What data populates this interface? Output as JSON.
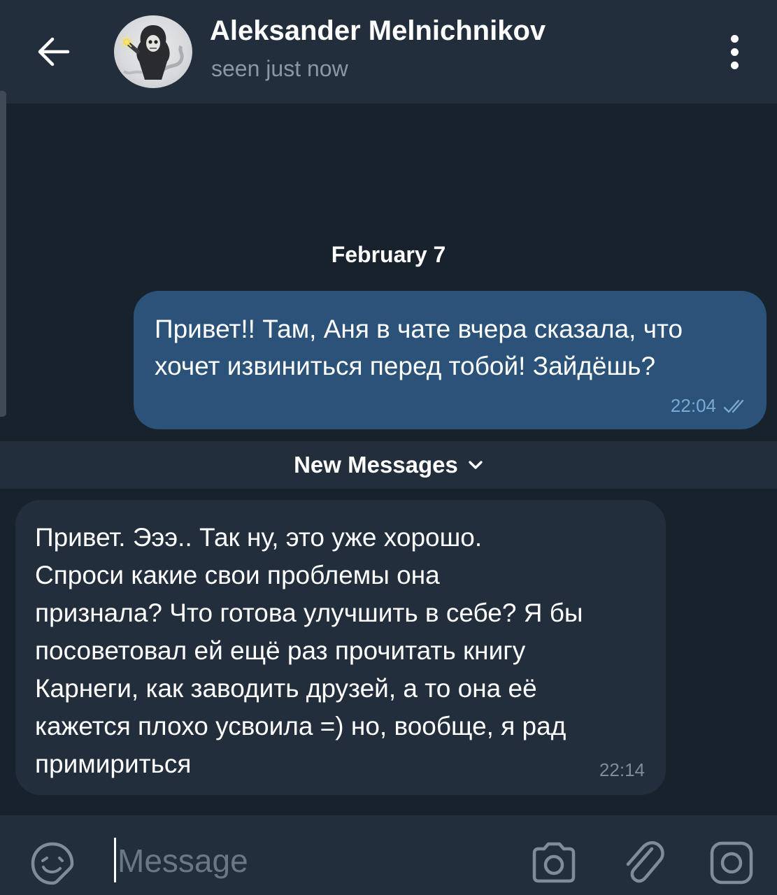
{
  "header": {
    "title": "Aleksander Melnichnikov",
    "status": "seen just now",
    "back_icon": "arrow-left-icon",
    "menu_icon": "more-vertical-icon"
  },
  "chat": {
    "date_label": "February 7",
    "messages": [
      {
        "direction": "outgoing",
        "lines": [
          "Привет!! Там, Аня в чате вчера сказала, что",
          "хочет извиниться перед тобой! Зайдёшь?"
        ],
        "time": "22:04",
        "status_icon": "double-check-icon"
      },
      {
        "direction": "incoming",
        "lines": [
          "Привет. Эээ.. Так ну, это уже хорошо.",
          "Спроси какие свои проблемы она",
          "признала? Что готова улучшить в себе? Я бы",
          "посоветовал ей ещё раз прочитать книгу",
          "Карнеги, как заводить друзей, а то она её",
          "кажется плохо усвоила =) но, вообще, я рад",
          "примириться"
        ],
        "time": "22:14"
      }
    ],
    "new_messages_label": "New Messages"
  },
  "composer": {
    "placeholder": "Message",
    "value": ""
  },
  "colors": {
    "background": "#18222d",
    "header": "#232e3c",
    "outgoing_bubble": "#2b5278",
    "incoming_bubble": "#232e3c",
    "secondary_text": "#8a97a6",
    "outgoing_meta": "#7da8d3"
  }
}
